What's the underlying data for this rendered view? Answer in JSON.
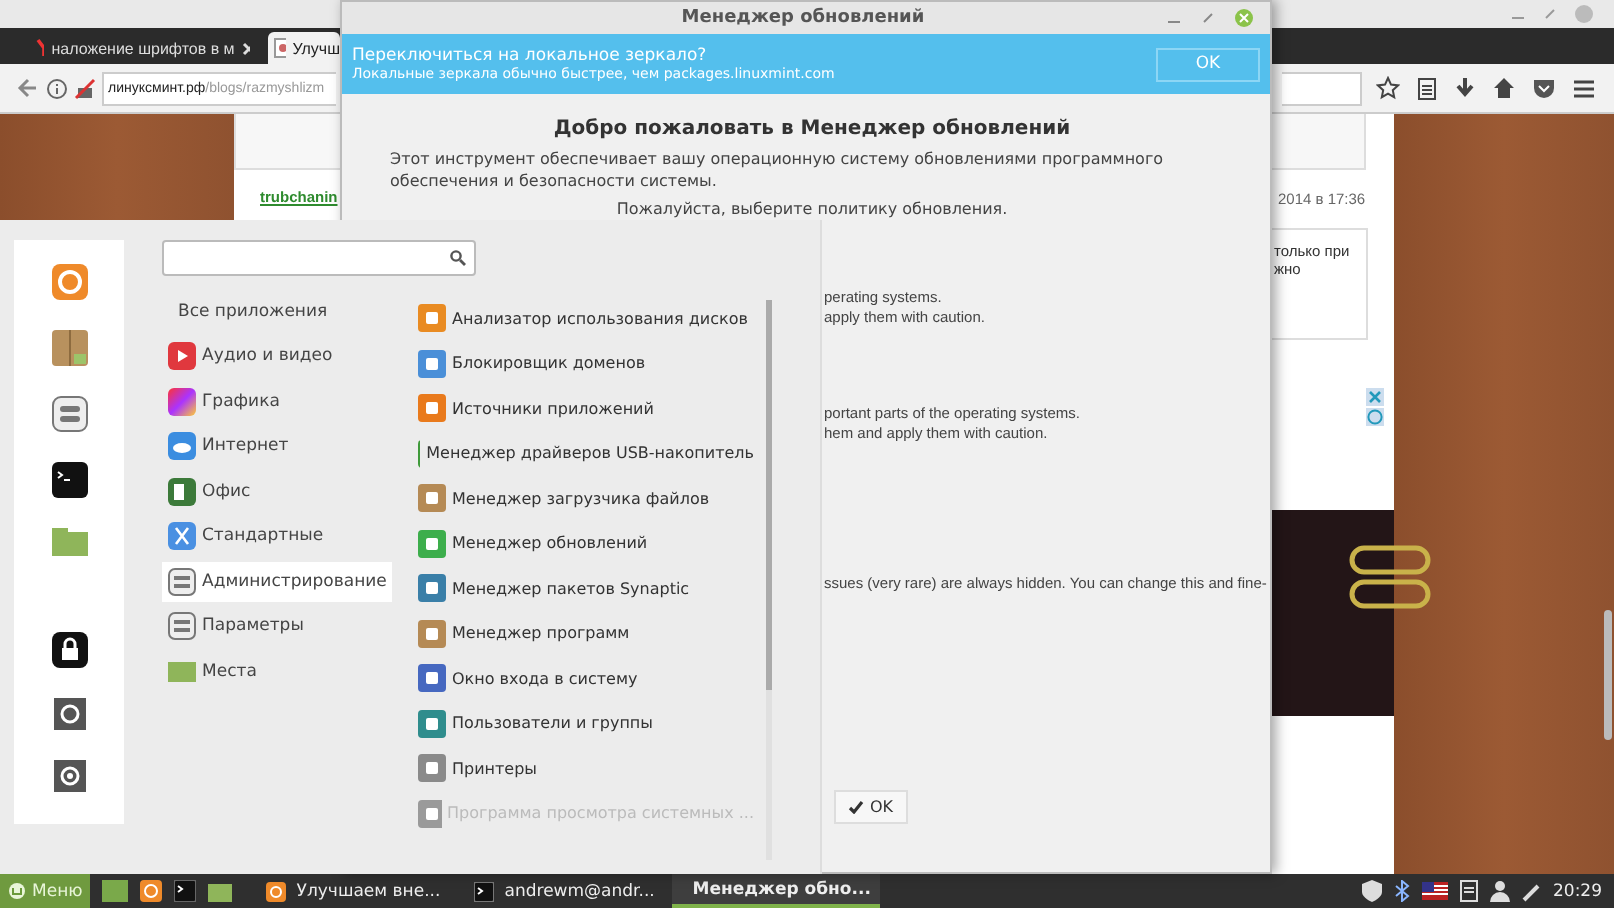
{
  "browser": {
    "tabs": [
      {
        "label": "наложение шрифтов в м",
        "selected": false
      },
      {
        "label": "Улучш",
        "selected": true
      }
    ],
    "address": {
      "host": "линуксминт.рф",
      "path": "/blogs/razmyshlizm"
    },
    "page": {
      "author_link": "trubchanin",
      "date": "2014 в 17:36",
      "comment_lines": [
        "только при",
        "жно"
      ]
    }
  },
  "update_manager": {
    "title": "Менеджер обновлений",
    "infobar": {
      "title": "Переключиться на локальное зеркало?",
      "text": "Локальные зеркала обычно быстрее, чем packages.linuxmint.com",
      "button": "OK"
    },
    "heading": "Добро пожаловать в Менеджер обновлений",
    "intro": "Этот инструмент обеспечивает вашу операционную систему обновлениями программного обеспечения и безопасности системы.",
    "prompt": "Пожалуйста, выберите политику обновления.",
    "fragments": [
      [
        "perating systems.",
        "apply them with caution."
      ],
      [
        "portant parts of the operating systems.",
        "hem and apply them with caution."
      ],
      [
        "ssues (very rare) are always hidden. You can change this and fine-"
      ]
    ],
    "ok_button": "OK"
  },
  "menu": {
    "categories": [
      {
        "label": "Все приложения",
        "selected": false
      },
      {
        "label": "Аудио и видео",
        "selected": false
      },
      {
        "label": "Графика",
        "selected": false
      },
      {
        "label": "Интернет",
        "selected": false
      },
      {
        "label": "Офис",
        "selected": false
      },
      {
        "label": "Стандартные",
        "selected": false
      },
      {
        "label": "Администрирование",
        "selected": true
      },
      {
        "label": "Параметры",
        "selected": false
      },
      {
        "label": "Места",
        "selected": false
      }
    ],
    "apps": [
      {
        "label": "Анализатор использования дисков",
        "dimmed": false,
        "color": "#e98b22"
      },
      {
        "label": "Блокировщик доменов",
        "dimmed": false,
        "color": "#4a8fd8"
      },
      {
        "label": "Источники приложений",
        "dimmed": false,
        "color": "#e97a1c"
      },
      {
        "label": "Менеджер драйверов USB-накопитель",
        "dimmed": false,
        "color": "#3f9a3a"
      },
      {
        "label": "Менеджер загрузчика файлов",
        "dimmed": false,
        "color": "#b58a55"
      },
      {
        "label": "Менеджер обновлений",
        "dimmed": false,
        "color": "#3dae4c"
      },
      {
        "label": "Менеджер пакетов Synaptic",
        "dimmed": false,
        "color": "#3a7fa8"
      },
      {
        "label": "Менеджер программ",
        "dimmed": false,
        "color": "#b58a55"
      },
      {
        "label": "Окно входа в систему",
        "dimmed": false,
        "color": "#4668c0"
      },
      {
        "label": "Пользователи и группы",
        "dimmed": false,
        "color": "#2f8d8d"
      },
      {
        "label": "Принтеры",
        "dimmed": false,
        "color": "#8a8a8a"
      },
      {
        "label": "Программа просмотра системных ...",
        "dimmed": true,
        "color": "#9a9a9a"
      }
    ]
  },
  "taskbar": {
    "menu_label": "Меню",
    "windows": [
      {
        "label": "Улучшаем вне...",
        "selected": false
      },
      {
        "label": "andrewm@andr...",
        "selected": false
      },
      {
        "label": "Менеджер обно...",
        "selected": true
      }
    ],
    "clock": "20:29"
  }
}
